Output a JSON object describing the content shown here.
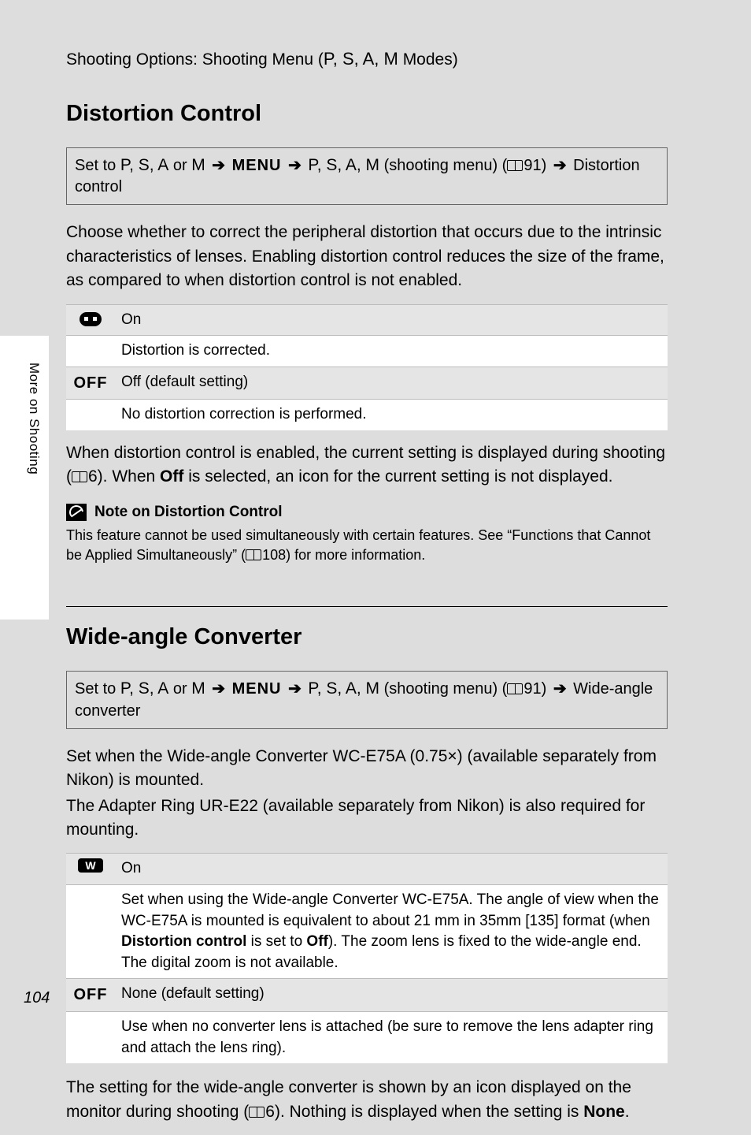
{
  "chapter_header": {
    "prefix": "Shooting Options: Shooting Menu (",
    "modes": "P, S, A, M",
    "suffix": " Modes)"
  },
  "side_tab": "More on Shooting",
  "page_number": "104",
  "section1": {
    "title": "Distortion Control",
    "nav": {
      "p1": "Set to ",
      "modes1": "P, S, A",
      "p2": " or ",
      "modeM": "M",
      "menu": "MENU",
      "modes2": "P, S, A, M",
      "p3": " (shooting menu) (",
      "ref": "91) ",
      "dest": " Distortion control"
    },
    "intro": "Choose whether to correct the peripheral distortion that occurs due to the intrinsic characteristics of lenses. Enabling distortion control reduces the size of the frame, as compared to when distortion control is not enabled.",
    "opt_on_label": "On",
    "opt_on_desc": "Distortion is corrected.",
    "opt_off_icon": "OFF",
    "opt_off_label": "Off (default setting)",
    "opt_off_desc": "No distortion correction is performed.",
    "after": {
      "p1": "When distortion control is enabled, the current setting is displayed during shooting (",
      "ref": "6). When ",
      "off": "Off",
      "p2": " is selected, an icon for the current setting is not displayed."
    },
    "note_title": "Note on Distortion Control",
    "note_body": {
      "p1": "This feature cannot be used simultaneously with certain features. See “Functions that Cannot be Applied Simultaneously” (",
      "ref": "108) for more information."
    }
  },
  "section2": {
    "title": "Wide-angle Converter",
    "nav": {
      "p1": "Set to ",
      "modes1": "P, S, A",
      "p2": " or ",
      "modeM": "M",
      "menu": "MENU",
      "modes2": "P, S, A, M",
      "p3": " (shooting menu) (",
      "ref": "91) ",
      "dest": " Wide-angle converter"
    },
    "intro1": "Set when the Wide-angle Converter WC-E75A (0.75×) (available separately from Nikon) is mounted.",
    "intro2": "The Adapter Ring UR-E22 (available separately from Nikon) is also required for mounting.",
    "opt_on_label": "On",
    "opt_on_desc": {
      "p1": "Set when using the Wide-angle Converter WC-E75A. The angle of view when the WC-E75A is mounted is equivalent to about 21 mm in 35mm [135] format (when ",
      "b1": "Distortion control",
      "p2": " is set to ",
      "b2": "Off",
      "p3": "). The zoom lens is fixed to the wide-angle end. The digital zoom is not available."
    },
    "opt_off_icon": "OFF",
    "opt_off_label": "None (default setting)",
    "opt_off_desc": "Use when no converter lens is attached (be sure to remove the lens adapter ring and attach the lens ring).",
    "after": {
      "p1": "The setting for the wide-angle converter is shown by an icon displayed on the monitor during shooting (",
      "ref": "6). Nothing is displayed when the setting is ",
      "none": "None",
      "p2": "."
    }
  }
}
